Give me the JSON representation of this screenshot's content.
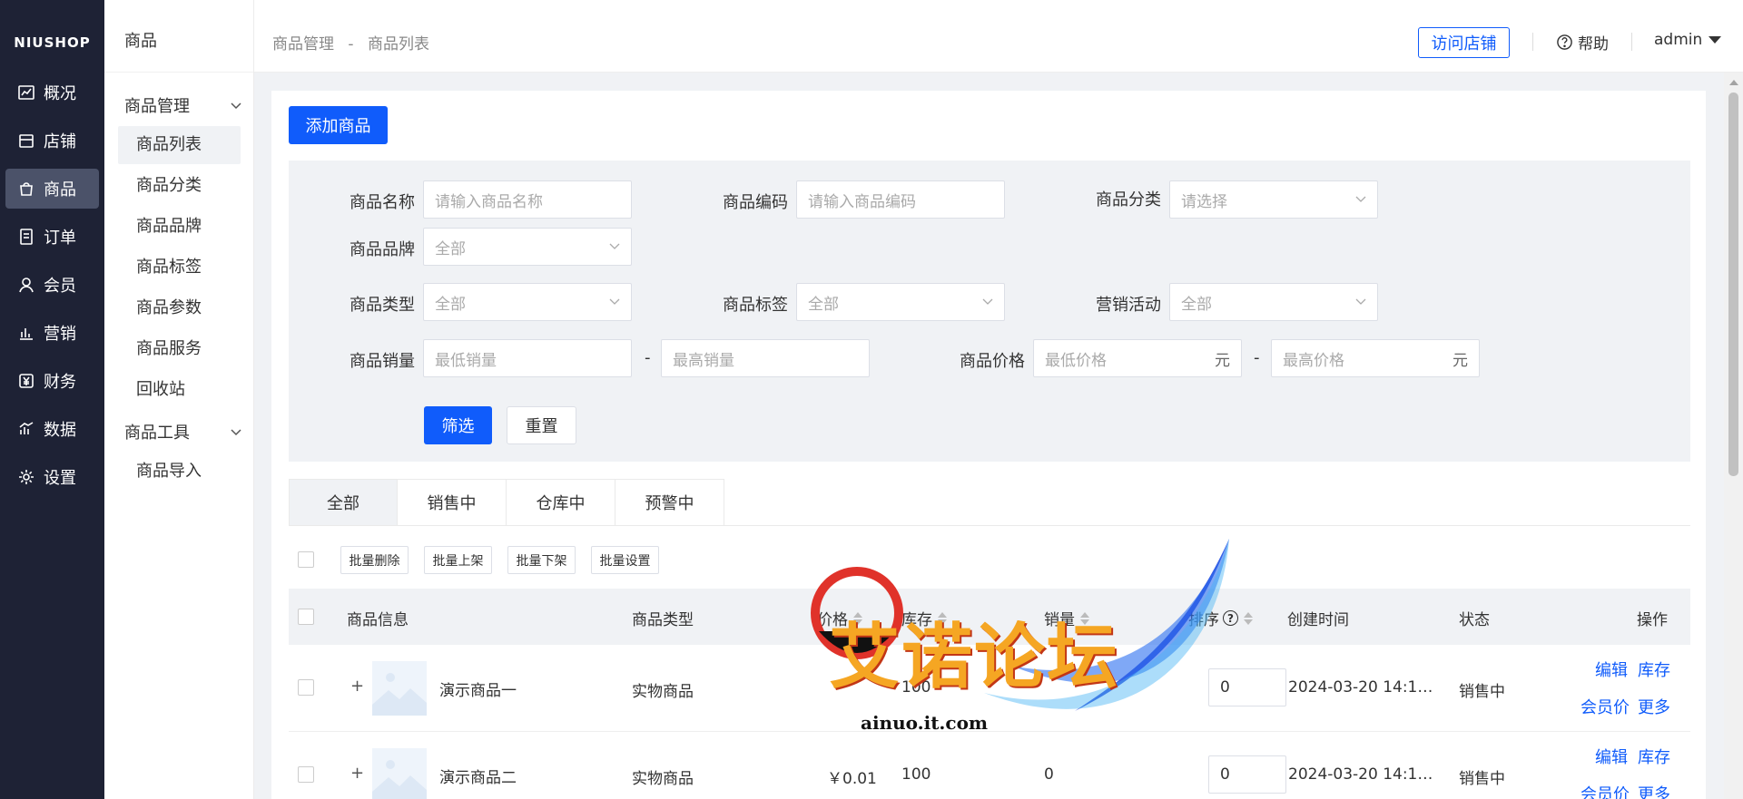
{
  "brand": "NIUSHOP",
  "nav": [
    {
      "label": "概况",
      "icon": "chart-line-icon"
    },
    {
      "label": "店铺",
      "icon": "store-icon"
    },
    {
      "label": "商品",
      "icon": "bag-icon",
      "active": true
    },
    {
      "label": "订单",
      "icon": "order-list-icon"
    },
    {
      "label": "会员",
      "icon": "user-icon"
    },
    {
      "label": "营销",
      "icon": "bar-chart-icon"
    },
    {
      "label": "财务",
      "icon": "yuan-icon"
    },
    {
      "label": "数据",
      "icon": "data-chart-icon"
    },
    {
      "label": "设置",
      "icon": "gear-icon"
    }
  ],
  "sidebar": {
    "title": "商品",
    "group1": "商品管理",
    "group1_items": [
      "商品列表",
      "商品分类",
      "商品品牌",
      "商品标签",
      "商品参数",
      "商品服务",
      "回收站"
    ],
    "group2": "商品工具",
    "group2_items": [
      "商品导入"
    ]
  },
  "header": {
    "breadcrumb_root": "商品管理",
    "breadcrumb_sep": "-",
    "breadcrumb_current": "商品列表",
    "visit_store": "访问店铺",
    "help": "帮助",
    "user": "admin"
  },
  "toolbar": {
    "add_label": "添加商品"
  },
  "filter": {
    "name_label": "商品名称",
    "name_placeholder": "请输入商品名称",
    "code_label": "商品编码",
    "code_placeholder": "请输入商品编码",
    "category_label": "商品分类",
    "category_placeholder": "请选择",
    "brand_label": "商品品牌",
    "brand_value": "全部",
    "type_label": "商品类型",
    "type_value": "全部",
    "tag_label": "商品标签",
    "tag_value": "全部",
    "activity_label": "营销活动",
    "activity_value": "全部",
    "sales_label": "商品销量",
    "sales_min_placeholder": "最低销量",
    "sales_max_placeholder": "最高销量",
    "price_label": "商品价格",
    "price_min_placeholder": "最低价格",
    "price_max_placeholder": "最高价格",
    "range_sep": "-",
    "unit": "元",
    "submit": "筛选",
    "reset": "重置"
  },
  "tabs": [
    "全部",
    "销售中",
    "仓库中",
    "预警中"
  ],
  "batch": [
    "批量删除",
    "批量上架",
    "批量下架",
    "批量设置"
  ],
  "columns": {
    "info": "商品信息",
    "type": "商品类型",
    "price": "价格",
    "stock": "库存",
    "sales": "销量",
    "sort": "排序",
    "created": "创建时间",
    "status": "状态",
    "ops": "操作"
  },
  "rows": [
    {
      "name": "演示商品一",
      "type": "实物商品",
      "price": "",
      "stock": "100",
      "sales": "",
      "sort": "0",
      "created": "2024-03-20 14:1…",
      "status": "销售中"
    },
    {
      "name": "演示商品二",
      "type": "实物商品",
      "price": "￥0.01",
      "stock": "100",
      "sales": "0",
      "sort": "0",
      "created": "2024-03-20 14:1…",
      "status": "销售中"
    }
  ],
  "ops": {
    "edit": "编辑",
    "stock": "库存",
    "member_price": "会员价",
    "more": "更多"
  },
  "watermark": {
    "text": "艾诺论坛",
    "url": "ainuo.it.com"
  }
}
